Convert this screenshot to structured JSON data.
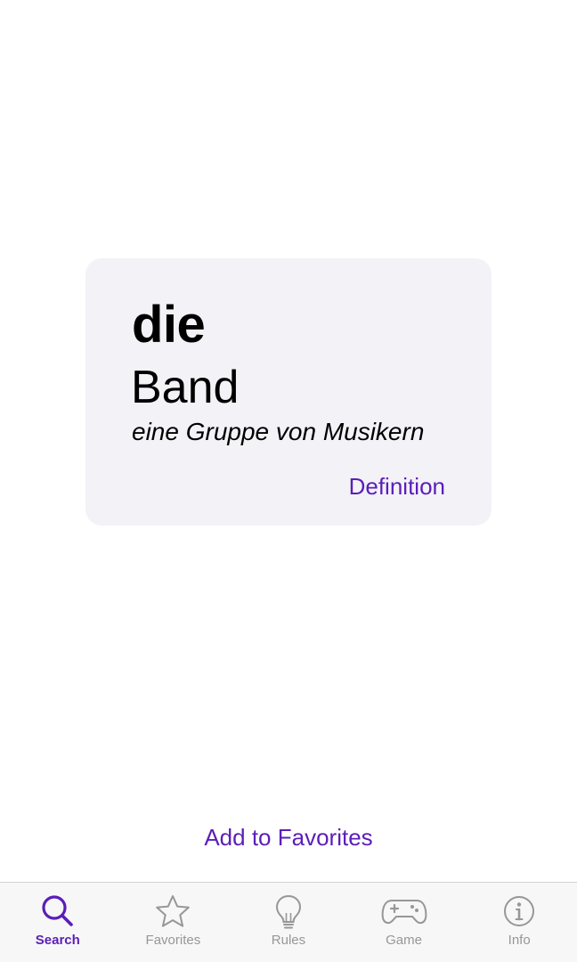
{
  "card": {
    "article": "die",
    "noun": "Band",
    "meaning": "eine Gruppe von Musikern",
    "definition_label": "Definition"
  },
  "actions": {
    "add_to_favorites_label": "Add to Favorites"
  },
  "tabbar": {
    "active": "search",
    "items": [
      {
        "id": "search",
        "label": "Search",
        "icon": "magnifier-icon"
      },
      {
        "id": "favorites",
        "label": "Favorites",
        "icon": "star-icon"
      },
      {
        "id": "rules",
        "label": "Rules",
        "icon": "lightbulb-icon"
      },
      {
        "id": "game",
        "label": "Game",
        "icon": "gamepad-icon"
      },
      {
        "id": "info",
        "label": "Info",
        "icon": "info-circle-icon"
      }
    ]
  },
  "colors": {
    "accent": "#5b1eb8",
    "inactive": "#979797",
    "card_bg": "#f3f2f7",
    "tabbar_bg": "#f7f7f7"
  }
}
